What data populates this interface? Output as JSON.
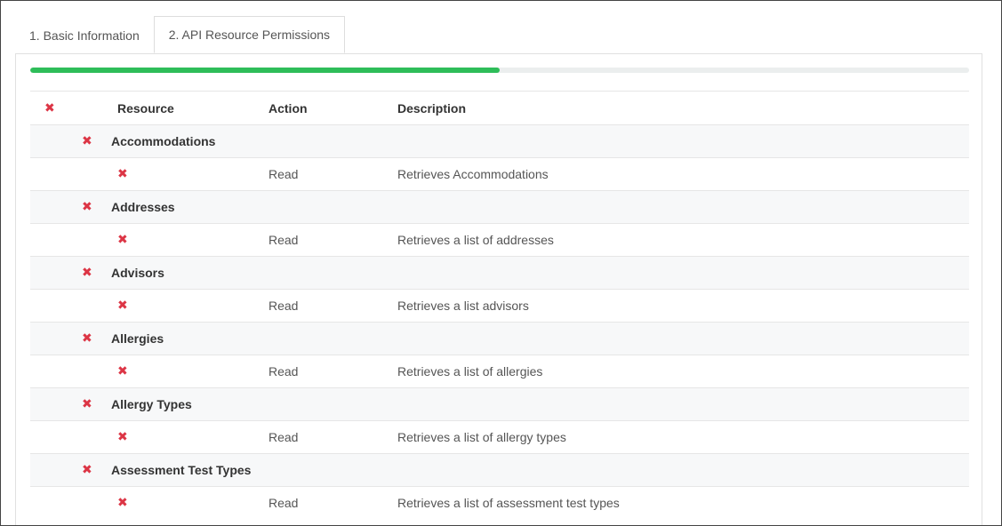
{
  "tabs": [
    {
      "label": "1. Basic Information",
      "active": false
    },
    {
      "label": "2. API Resource Permissions",
      "active": true
    }
  ],
  "progress": {
    "percent": 50
  },
  "icons": {
    "remove": "✖"
  },
  "colors": {
    "accent": "#2ebd59",
    "remove": "#dc3545"
  },
  "table": {
    "headers": {
      "resource": "Resource",
      "action": "Action",
      "description": "Description"
    },
    "groups": [
      {
        "name": "Accommodations",
        "action": "Read",
        "description": "Retrieves Accommodations"
      },
      {
        "name": "Addresses",
        "action": "Read",
        "description": "Retrieves a list of addresses"
      },
      {
        "name": "Advisors",
        "action": "Read",
        "description": "Retrieves a list advisors"
      },
      {
        "name": "Allergies",
        "action": "Read",
        "description": "Retrieves a list of allergies"
      },
      {
        "name": "Allergy Types",
        "action": "Read",
        "description": "Retrieves a list of allergy types"
      },
      {
        "name": "Assessment Test Types",
        "action": "Read",
        "description": "Retrieves a list of assessment test types"
      }
    ]
  }
}
